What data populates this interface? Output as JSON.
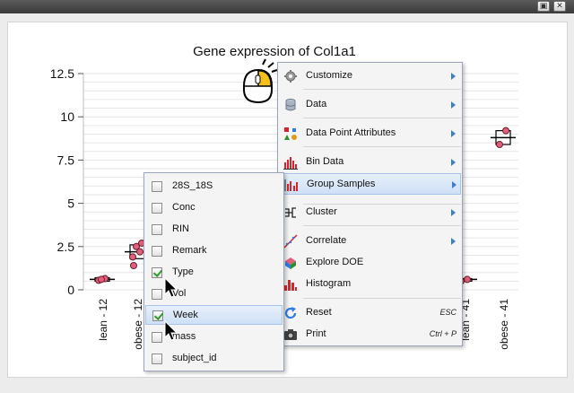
{
  "window": {
    "restore_glyph": "▣",
    "close_glyph": "✕"
  },
  "chart_data": {
    "type": "scatter",
    "title": "Gene expression of Col1a1",
    "xlabel": "",
    "ylabel": "",
    "ylim": [
      0,
      12.5
    ],
    "yticks": [
      "0",
      "2.5",
      "5",
      "7.5",
      "10",
      "12.5"
    ],
    "grid": true,
    "visible_categories": [
      "lean - 12",
      "obese - 12",
      "lean - 41",
      "obese - 41"
    ],
    "groups": [
      {
        "name": "lean - 12",
        "values": [
          0.55,
          0.65,
          0.6
        ],
        "box": [
          0.5,
          0.6,
          0.7
        ]
      },
      {
        "name": "obese - 12",
        "values": [
          1.4,
          2.2,
          2.5,
          2.7,
          1.9
        ],
        "box": [
          1.8,
          2.2,
          2.6
        ]
      },
      {
        "name": "lean - 41",
        "values": [
          0.5,
          0.6
        ],
        "box": [
          0.55,
          0.6,
          0.65
        ]
      },
      {
        "name": "obese - 41",
        "values": [
          8.4,
          9.2
        ],
        "box": [
          8.4,
          8.8,
          9.2
        ]
      }
    ],
    "point_color": "#e0607c",
    "box_color": "#000000"
  },
  "menu": {
    "items": [
      {
        "label": "Customize",
        "icon": "gear-icon",
        "submenu": true
      },
      {
        "label": "Data",
        "icon": "database-icon",
        "submenu": true
      },
      {
        "label": "Data Point Attributes",
        "icon": "shapes-icon",
        "submenu": true
      },
      {
        "label": "Bin Data",
        "icon": "histogram-bins-icon",
        "submenu": true
      },
      {
        "label": "Group Samples",
        "icon": "group-chart-icon",
        "submenu": true,
        "highlighted": true
      },
      {
        "label": "Cluster",
        "icon": "dendrogram-icon",
        "submenu": true
      },
      {
        "label": "Correlate",
        "icon": "correlate-icon",
        "submenu": true
      },
      {
        "label": "Explore DOE",
        "icon": "doe-icon",
        "submenu": false
      },
      {
        "label": "Histogram",
        "icon": "histogram-icon",
        "submenu": false
      },
      {
        "label": "Reset",
        "icon": "reset-icon",
        "shortcut": "ESC"
      },
      {
        "label": "Print",
        "icon": "camera-icon",
        "shortcut": "Ctrl + P"
      }
    ]
  },
  "submenu": {
    "items": [
      {
        "label": "28S_18S",
        "checked": false
      },
      {
        "label": "Conc",
        "checked": false
      },
      {
        "label": "RIN",
        "checked": false
      },
      {
        "label": "Remark",
        "checked": false
      },
      {
        "label": "Type",
        "checked": true
      },
      {
        "label": "Vol",
        "checked": false
      },
      {
        "label": "Week",
        "checked": true,
        "highlighted": true
      },
      {
        "label": "mass",
        "checked": false
      },
      {
        "label": "subject_id",
        "checked": false
      }
    ]
  }
}
